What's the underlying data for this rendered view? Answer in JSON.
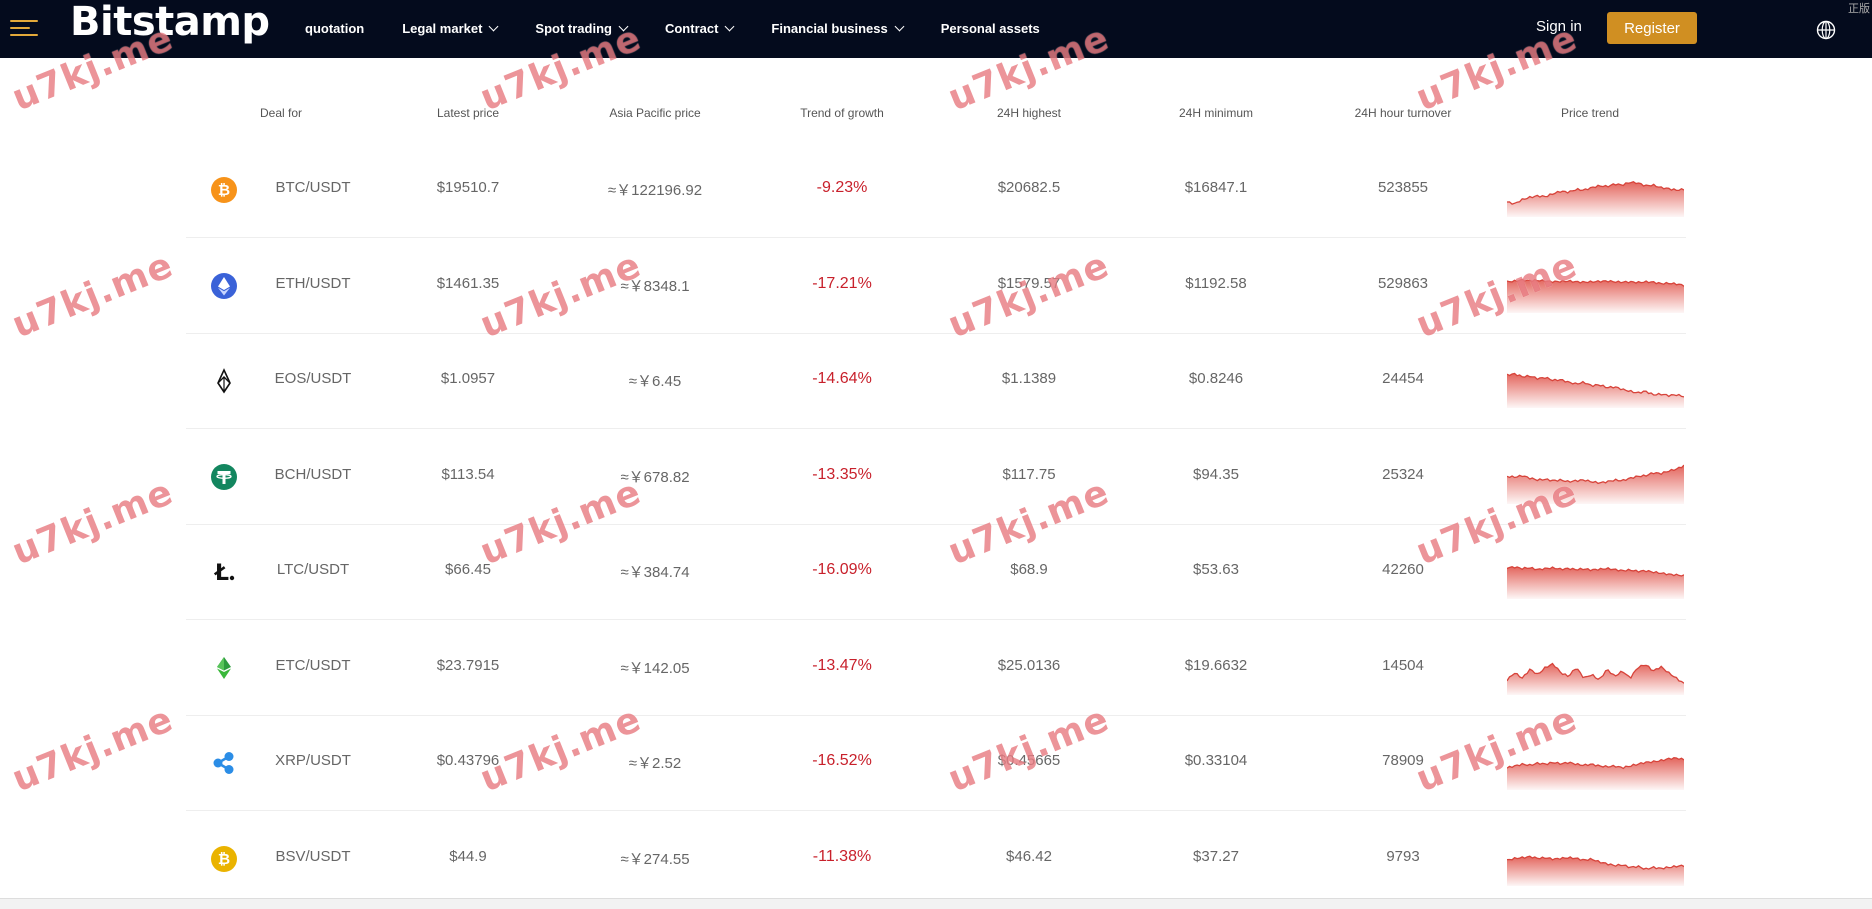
{
  "header": {
    "logo": "Bitstamp",
    "nav": [
      {
        "label": "quotation",
        "dropdown": false
      },
      {
        "label": "Legal market",
        "dropdown": true
      },
      {
        "label": "Spot trading",
        "dropdown": true
      },
      {
        "label": "Contract",
        "dropdown": true
      },
      {
        "label": "Financial business",
        "dropdown": true
      },
      {
        "label": "Personal assets",
        "dropdown": false
      }
    ],
    "sign_in": "Sign in",
    "register": "Register",
    "corner_text": "正版"
  },
  "table": {
    "columns": [
      "Deal for",
      "Latest price",
      "Asia Pacific price",
      "Trend of growth",
      "24H highest",
      "24H minimum",
      "24H hour turnover",
      "Price trend"
    ],
    "rows": [
      {
        "icon": "bitcoin-icon",
        "color": "#f7931a",
        "pair": "BTC/USDT",
        "latest": "$19510.7",
        "asia": "≈￥122196.92",
        "trend": "-9.23%",
        "high": "$20682.5",
        "low": "$16847.1",
        "turnover": "523855"
      },
      {
        "icon": "ethereum-icon",
        "color": "#3a62d8",
        "pair": "ETH/USDT",
        "latest": "$1461.35",
        "asia": "≈￥8348.1",
        "trend": "-17.21%",
        "high": "$1579.57",
        "low": "$1192.58",
        "turnover": "529863"
      },
      {
        "icon": "eos-icon",
        "color": "#111111",
        "pair": "EOS/USDT",
        "latest": "$1.0957",
        "asia": "≈￥6.45",
        "trend": "-14.64%",
        "high": "$1.1389",
        "low": "$0.8246",
        "turnover": "24454"
      },
      {
        "icon": "tether-icon",
        "color": "#13865f",
        "pair": "BCH/USDT",
        "latest": "$113.54",
        "asia": "≈￥678.82",
        "trend": "-13.35%",
        "high": "$117.75",
        "low": "$94.35",
        "turnover": "25324"
      },
      {
        "icon": "litecoin-icon",
        "color": "#111111",
        "pair": "LTC/USDT",
        "latest": "$66.45",
        "asia": "≈￥384.74",
        "trend": "-16.09%",
        "high": "$68.9",
        "low": "$53.63",
        "turnover": "42260"
      },
      {
        "icon": "ethereum-classic-icon",
        "color": "#2e9c3e",
        "pair": "ETC/USDT",
        "latest": "$23.7915",
        "asia": "≈￥142.05",
        "trend": "-13.47%",
        "high": "$25.0136",
        "low": "$19.6632",
        "turnover": "14504"
      },
      {
        "icon": "ripple-icon",
        "color": "#2b8de6",
        "pair": "XRP/USDT",
        "latest": "$0.43796",
        "asia": "≈￥2.52",
        "trend": "-16.52%",
        "high": "$0.45665",
        "low": "$0.33104",
        "turnover": "78909"
      },
      {
        "icon": "bitcoin-sv-icon",
        "color": "#eab300",
        "pair": "BSV/USDT",
        "latest": "$44.9",
        "asia": "≈￥274.55",
        "trend": "-11.38%",
        "high": "$46.42",
        "low": "$37.27",
        "turnover": "9793"
      }
    ]
  },
  "watermark": "u7kj.me",
  "colors": {
    "header_bg": "#040b1d",
    "register_bg": "#d08f22",
    "negative": "#c8202b",
    "sparkline": "#e0544b"
  }
}
